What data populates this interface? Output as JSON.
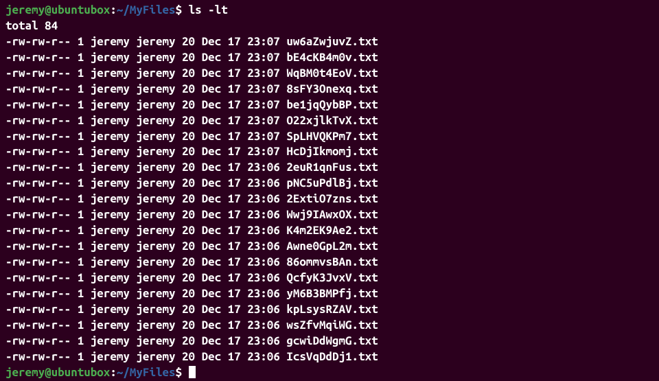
{
  "prompt1": {
    "user_host": "jeremy@ubuntubox",
    "colon": ":",
    "path": "~/MyFiles",
    "dollar": "$ ",
    "command": "ls -lt"
  },
  "total_line": "total 84",
  "files": [
    {
      "perms": "-rw-rw-r--",
      "links": "1",
      "owner": "jeremy",
      "group": "jeremy",
      "size": "20",
      "month": "Dec",
      "day": "17",
      "time": "23:07",
      "name": "uw6aZwjuvZ.txt"
    },
    {
      "perms": "-rw-rw-r--",
      "links": "1",
      "owner": "jeremy",
      "group": "jeremy",
      "size": "20",
      "month": "Dec",
      "day": "17",
      "time": "23:07",
      "name": "bE4cKB4m0v.txt"
    },
    {
      "perms": "-rw-rw-r--",
      "links": "1",
      "owner": "jeremy",
      "group": "jeremy",
      "size": "20",
      "month": "Dec",
      "day": "17",
      "time": "23:07",
      "name": "WqBM0t4EoV.txt"
    },
    {
      "perms": "-rw-rw-r--",
      "links": "1",
      "owner": "jeremy",
      "group": "jeremy",
      "size": "20",
      "month": "Dec",
      "day": "17",
      "time": "23:07",
      "name": "8sFY3Onexq.txt"
    },
    {
      "perms": "-rw-rw-r--",
      "links": "1",
      "owner": "jeremy",
      "group": "jeremy",
      "size": "20",
      "month": "Dec",
      "day": "17",
      "time": "23:07",
      "name": "be1jqQybBP.txt"
    },
    {
      "perms": "-rw-rw-r--",
      "links": "1",
      "owner": "jeremy",
      "group": "jeremy",
      "size": "20",
      "month": "Dec",
      "day": "17",
      "time": "23:07",
      "name": "O22xjlkTvX.txt"
    },
    {
      "perms": "-rw-rw-r--",
      "links": "1",
      "owner": "jeremy",
      "group": "jeremy",
      "size": "20",
      "month": "Dec",
      "day": "17",
      "time": "23:07",
      "name": "SpLHVQKPm7.txt"
    },
    {
      "perms": "-rw-rw-r--",
      "links": "1",
      "owner": "jeremy",
      "group": "jeremy",
      "size": "20",
      "month": "Dec",
      "day": "17",
      "time": "23:07",
      "name": "HcDjIkmomj.txt"
    },
    {
      "perms": "-rw-rw-r--",
      "links": "1",
      "owner": "jeremy",
      "group": "jeremy",
      "size": "20",
      "month": "Dec",
      "day": "17",
      "time": "23:06",
      "name": "2euR1qnFus.txt"
    },
    {
      "perms": "-rw-rw-r--",
      "links": "1",
      "owner": "jeremy",
      "group": "jeremy",
      "size": "20",
      "month": "Dec",
      "day": "17",
      "time": "23:06",
      "name": "pNC5uPdlBj.txt"
    },
    {
      "perms": "-rw-rw-r--",
      "links": "1",
      "owner": "jeremy",
      "group": "jeremy",
      "size": "20",
      "month": "Dec",
      "day": "17",
      "time": "23:06",
      "name": "2ExtiO7zns.txt"
    },
    {
      "perms": "-rw-rw-r--",
      "links": "1",
      "owner": "jeremy",
      "group": "jeremy",
      "size": "20",
      "month": "Dec",
      "day": "17",
      "time": "23:06",
      "name": "Wwj9IAwxOX.txt"
    },
    {
      "perms": "-rw-rw-r--",
      "links": "1",
      "owner": "jeremy",
      "group": "jeremy",
      "size": "20",
      "month": "Dec",
      "day": "17",
      "time": "23:06",
      "name": "K4m2EK9Ae2.txt"
    },
    {
      "perms": "-rw-rw-r--",
      "links": "1",
      "owner": "jeremy",
      "group": "jeremy",
      "size": "20",
      "month": "Dec",
      "day": "17",
      "time": "23:06",
      "name": "Awne0GpL2m.txt"
    },
    {
      "perms": "-rw-rw-r--",
      "links": "1",
      "owner": "jeremy",
      "group": "jeremy",
      "size": "20",
      "month": "Dec",
      "day": "17",
      "time": "23:06",
      "name": "86ommvsBAn.txt"
    },
    {
      "perms": "-rw-rw-r--",
      "links": "1",
      "owner": "jeremy",
      "group": "jeremy",
      "size": "20",
      "month": "Dec",
      "day": "17",
      "time": "23:06",
      "name": "QcfyK3JvxV.txt"
    },
    {
      "perms": "-rw-rw-r--",
      "links": "1",
      "owner": "jeremy",
      "group": "jeremy",
      "size": "20",
      "month": "Dec",
      "day": "17",
      "time": "23:06",
      "name": "yM6B3BMPfj.txt"
    },
    {
      "perms": "-rw-rw-r--",
      "links": "1",
      "owner": "jeremy",
      "group": "jeremy",
      "size": "20",
      "month": "Dec",
      "day": "17",
      "time": "23:06",
      "name": "kpLsysRZAV.txt"
    },
    {
      "perms": "-rw-rw-r--",
      "links": "1",
      "owner": "jeremy",
      "group": "jeremy",
      "size": "20",
      "month": "Dec",
      "day": "17",
      "time": "23:06",
      "name": "wsZfvMqiWG.txt"
    },
    {
      "perms": "-rw-rw-r--",
      "links": "1",
      "owner": "jeremy",
      "group": "jeremy",
      "size": "20",
      "month": "Dec",
      "day": "17",
      "time": "23:06",
      "name": "gcwiDdWgmG.txt"
    },
    {
      "perms": "-rw-rw-r--",
      "links": "1",
      "owner": "jeremy",
      "group": "jeremy",
      "size": "20",
      "month": "Dec",
      "day": "17",
      "time": "23:06",
      "name": "IcsVqDdDj1.txt"
    }
  ],
  "prompt2": {
    "user_host": "jeremy@ubuntubox",
    "colon": ":",
    "path": "~/MyFiles",
    "dollar": "$ "
  }
}
